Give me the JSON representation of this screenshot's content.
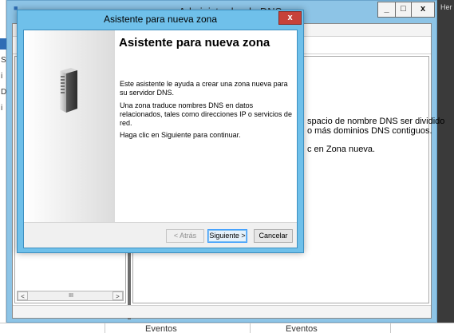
{
  "desktop": {
    "right_strip_text": "Her",
    "left_strip_items": [
      "S",
      "i",
      "D",
      "i"
    ]
  },
  "dns_window": {
    "title": "Administrador de DNS",
    "app_icon": "dns-icon",
    "buttons": {
      "minimize": "_",
      "maximize": "□",
      "close": "x"
    },
    "content_lines": [
      "spacio de nombre DNS ser dividido",
      "o más dominios DNS contiguos.",
      "c en Zona nueva."
    ],
    "tree_scroll": {
      "left_arrow": "<",
      "thumb": "III",
      "right_arrow": ">"
    }
  },
  "events_bar": {
    "left_label": "Eventos",
    "right_label": "Eventos"
  },
  "wizard": {
    "title": "Asistente para nueva zona",
    "close_label": "x",
    "heading": "Asistente para nueva zona",
    "paragraph1": "Este asistente le ayuda a crear una zona nueva para su servidor DNS.",
    "paragraph2": "Una zona traduce nombres DNS en datos relacionados, tales como direcciones IP o servicios de red.",
    "paragraph3": "Haga clic en Siguiente para continuar.",
    "banner_icon": "server-icon",
    "buttons": {
      "back": "< Atrás",
      "next": "Siguiente >",
      "cancel": "Cancelar"
    },
    "colors": {
      "frame": "#6fc0ea",
      "close": "#c7423a"
    }
  }
}
